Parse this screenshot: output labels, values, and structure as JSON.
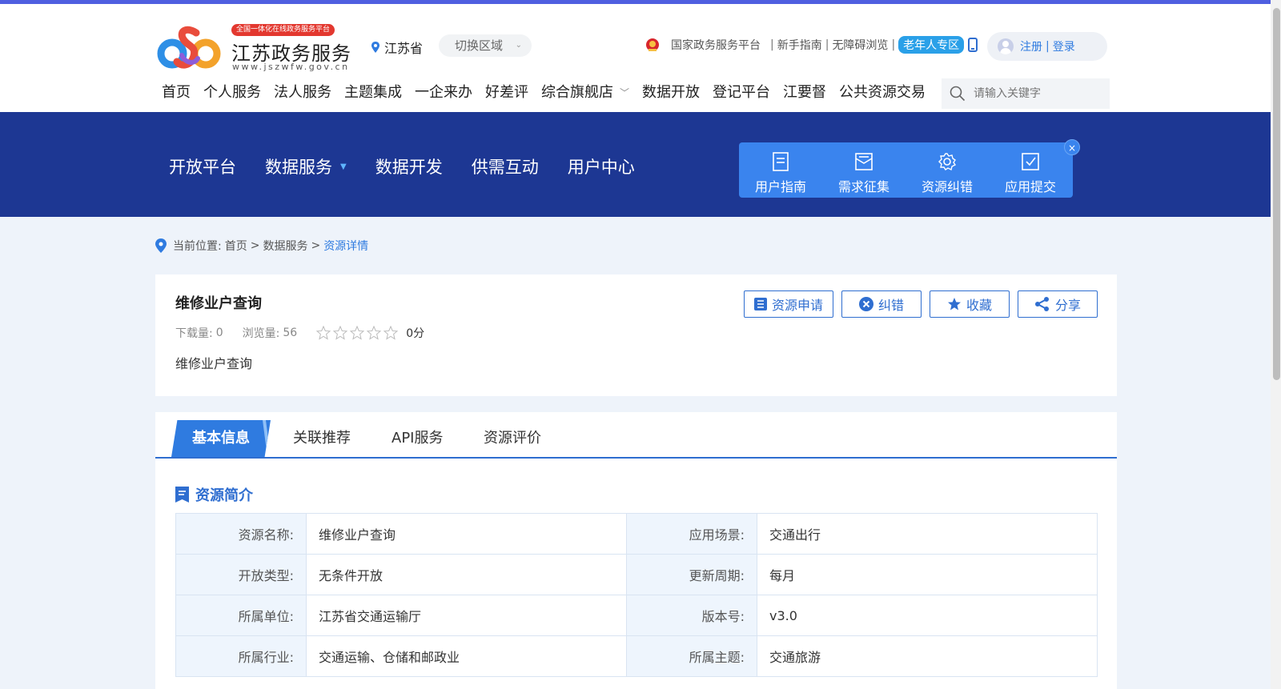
{
  "header": {
    "logo_badge": "全国一体化在线政务服务平台",
    "logo_name": "江苏政务服务",
    "logo_url": "www.jszwfw.gov.cn",
    "region": "江苏省",
    "switch_region": "切换区域",
    "links": [
      "国家政务服务平台",
      "新手指南",
      "无障碍浏览",
      "老年人专区"
    ],
    "separator": "|",
    "register": "注册",
    "login": "登录",
    "nav": [
      "首页",
      "个人服务",
      "法人服务",
      "主题集成",
      "一企来办",
      "好差评",
      "综合旗舰店",
      "数据开放",
      "登记平台",
      "江要督",
      "公共资源交易"
    ],
    "nav_active_index": 7,
    "search_placeholder": "请输入关键字"
  },
  "banner": {
    "subnav": [
      "开放平台",
      "数据服务",
      "数据开发",
      "供需互动",
      "用户中心"
    ],
    "quick": [
      "用户指南",
      "需求征集",
      "资源纠错",
      "应用提交"
    ],
    "close": "×"
  },
  "breadcrumb": {
    "prefix": "当前位置:",
    "items": [
      "首页",
      "数据服务",
      "资源详情"
    ],
    "sep": ">"
  },
  "resource": {
    "title": "维修业户查询",
    "downloads_label": "下载量:",
    "downloads": "0",
    "views_label": "浏览量:",
    "views": "56",
    "rating": 0,
    "score": "0分",
    "description": "维修业户查询",
    "actions": [
      "资源申请",
      "纠错",
      "收藏",
      "分享"
    ]
  },
  "tabs": [
    "基本信息",
    "关联推荐",
    "API服务",
    "资源评价"
  ],
  "section_title": "资源简介",
  "info_rows": [
    [
      "资源名称:",
      "维修业户查询",
      "应用场景:",
      "交通出行"
    ],
    [
      "开放类型:",
      "无条件开放",
      "更新周期:",
      "每月"
    ],
    [
      "所属单位:",
      "江苏省交通运输厅",
      "版本号:",
      "v3.0"
    ],
    [
      "所属行业:",
      "交通运输、仓储和邮政业",
      "所属主题:",
      "交通旅游"
    ]
  ],
  "colors": {
    "primary": "#2f6ed0",
    "banner": "#1d3793",
    "accent": "#3a84ee",
    "badge": "#e3382f"
  }
}
